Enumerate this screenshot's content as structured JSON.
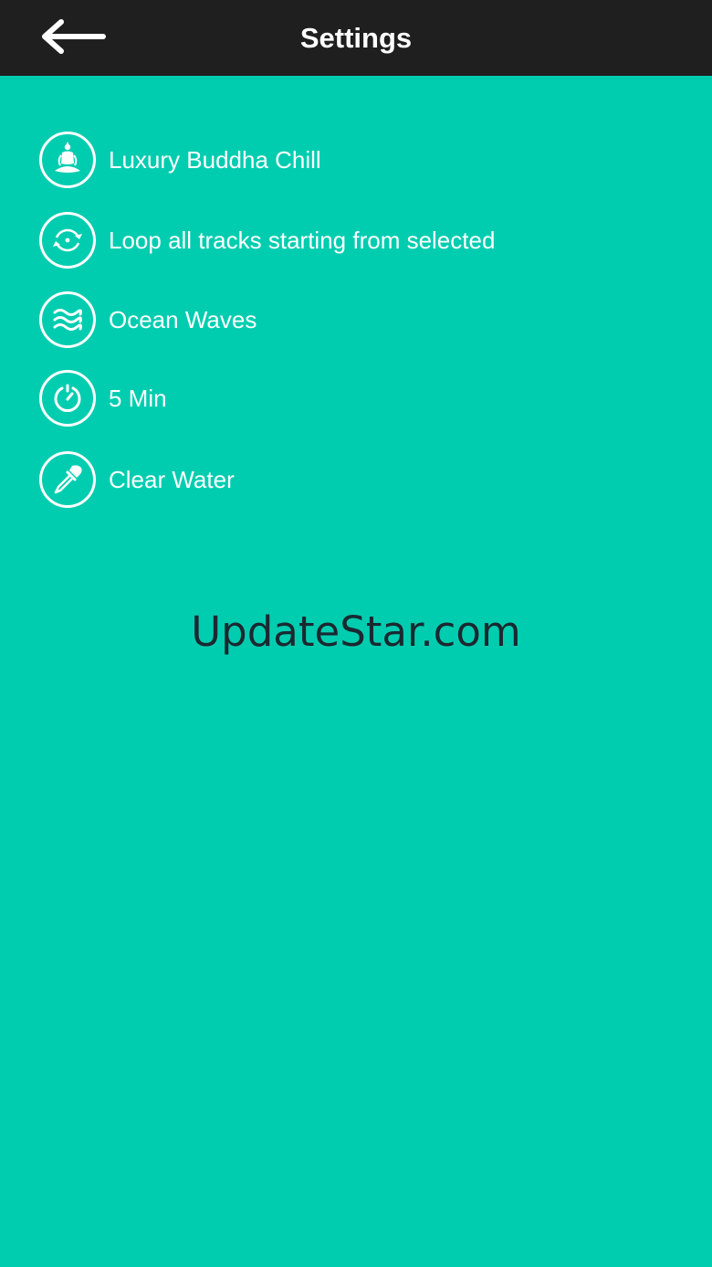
{
  "header": {
    "title": "Settings",
    "back_icon": "arrow-left-icon"
  },
  "settings": {
    "items": [
      {
        "id": "sound",
        "icon": "buddha-icon",
        "label": "Luxury Buddha Chill"
      },
      {
        "id": "repeat",
        "icon": "loop-icon",
        "label": "Loop all tracks starting from selected"
      },
      {
        "id": "ambient",
        "icon": "waves-icon",
        "label": "Ocean Waves"
      },
      {
        "id": "timer",
        "icon": "timer-icon",
        "label": "5 Min"
      },
      {
        "id": "theme",
        "icon": "dropper-icon",
        "label": "Clear Water"
      }
    ]
  },
  "watermark": {
    "text": "UpdateStar.com"
  },
  "colors": {
    "background": "#00CDB0",
    "topbar": "#1F1F1F",
    "text": "#FFFFFF",
    "watermark": "#1B2830"
  }
}
